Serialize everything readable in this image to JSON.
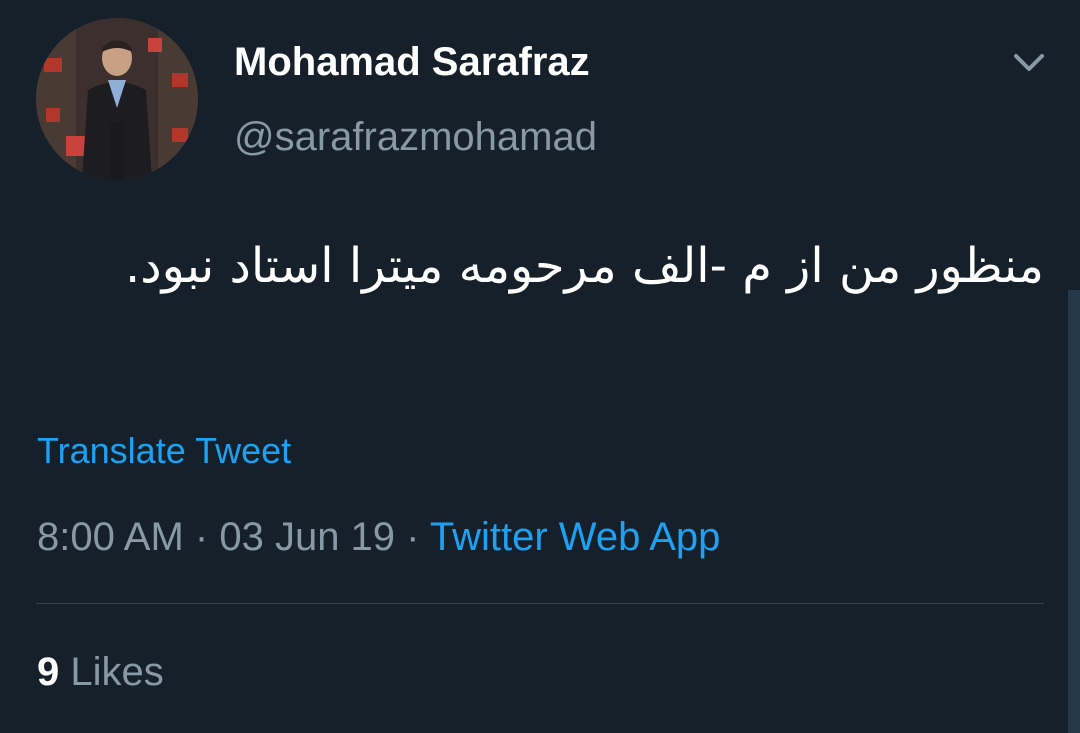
{
  "author": {
    "display_name": "Mohamad Sarafraz",
    "handle": "@sarafrazmohamad",
    "avatar_icon": "profile-photo"
  },
  "tweet": {
    "text": "منظور من از م -الف مرحومه میترا استاد نبود.",
    "translate_label": "Translate Tweet",
    "time": "8:00 AM",
    "separator": "·",
    "date": "03 Jun 19",
    "source": "Twitter Web App"
  },
  "stats": {
    "likes_count": "9",
    "likes_label": "Likes"
  },
  "icons": {
    "menu": "chevron-down-icon"
  },
  "colors": {
    "background": "#15202b",
    "primary_text": "#ffffff",
    "secondary_text": "#8899a6",
    "link": "#1da1f2",
    "divider": "#38444d"
  }
}
